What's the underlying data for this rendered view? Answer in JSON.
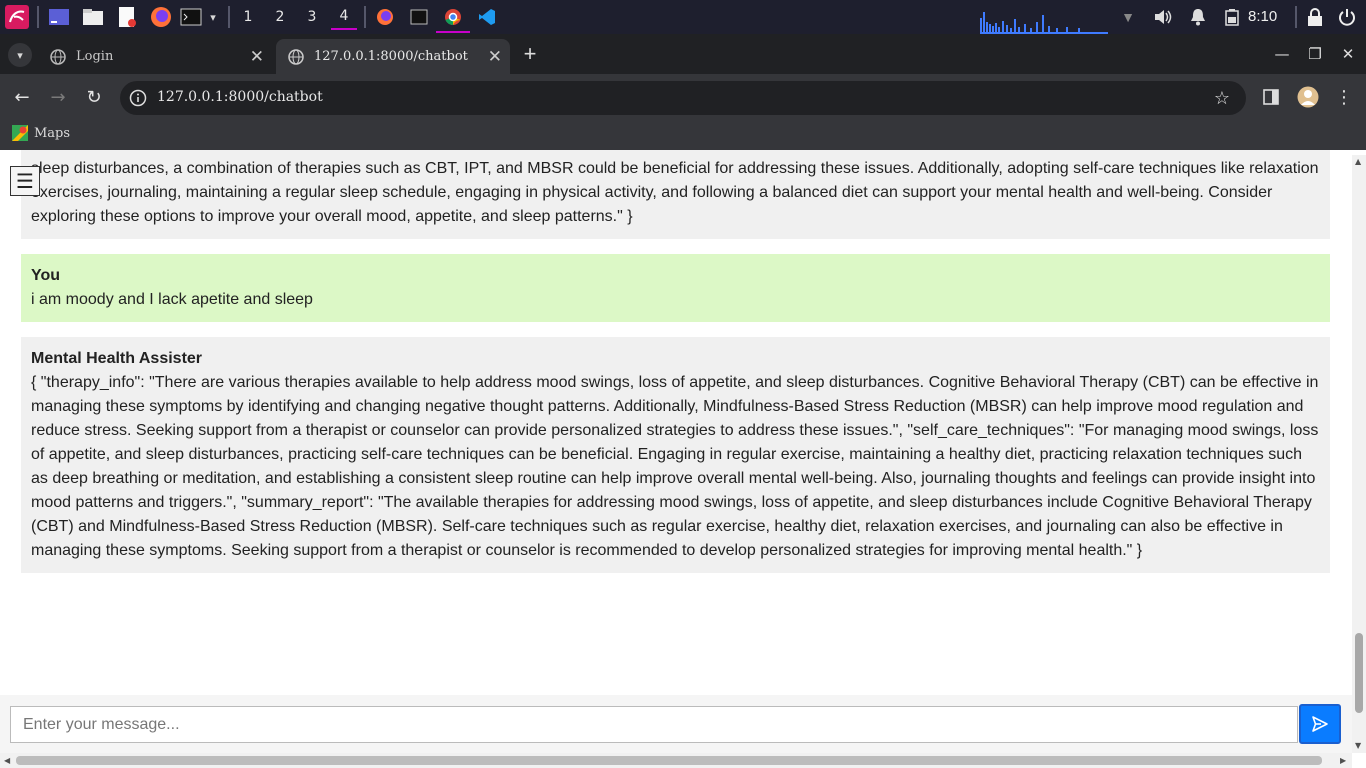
{
  "taskbar": {
    "workspaces": [
      "1",
      "2",
      "3",
      "4"
    ],
    "active_workspace": "4",
    "clock": "8:10"
  },
  "browser": {
    "tabs": [
      {
        "title": "Login",
        "active": false
      },
      {
        "title": "127.0.0.1:8000/chatbot",
        "active": true
      }
    ],
    "new_tab": "+",
    "url": "127.0.0.1:8000/chatbot",
    "bookmarks": [
      {
        "label": "Maps"
      }
    ]
  },
  "chat": {
    "menu_glyph": "☰",
    "messages": [
      {
        "sender": "",
        "role": "bot",
        "text": "sleep disturbances, a combination of therapies such as CBT, IPT, and MBSR could be beneficial for addressing these issues. Additionally, adopting self-care techniques like relaxation exercises, journaling, maintaining a regular sleep schedule, engaging in physical activity, and following a balanced diet can support your mental health and well-being. Consider exploring these options to improve your overall mood, appetite, and sleep patterns.\" }"
      },
      {
        "sender": "You",
        "role": "user",
        "text": "i am moody and I lack apetite and sleep"
      },
      {
        "sender": "Mental Health Assister",
        "role": "bot",
        "text": "{ \"therapy_info\": \"There are various therapies available to help address mood swings, loss of appetite, and sleep disturbances. Cognitive Behavioral Therapy (CBT) can be effective in managing these symptoms by identifying and changing negative thought patterns. Additionally, Mindfulness-Based Stress Reduction (MBSR) can help improve mood regulation and reduce stress. Seeking support from a therapist or counselor can provide personalized strategies to address these issues.\", \"self_care_techniques\": \"For managing mood swings, loss of appetite, and sleep disturbances, practicing self-care techniques can be beneficial. Engaging in regular exercise, maintaining a healthy diet, practicing relaxation techniques such as deep breathing or meditation, and establishing a consistent sleep routine can help improve overall mental well-being. Also, journaling thoughts and feelings can provide insight into mood patterns and triggers.\", \"summary_report\": \"The available therapies for addressing mood swings, loss of appetite, and sleep disturbances include Cognitive Behavioral Therapy (CBT) and Mindfulness-Based Stress Reduction (MBSR). Self-care techniques such as regular exercise, healthy diet, relaxation exercises, and journaling can also be effective in managing these symptoms. Seeking support from a therapist or counselor is recommended to develop personalized strategies for improving mental health.\" }"
      }
    ],
    "input": {
      "placeholder": "Enter your message...",
      "value": ""
    }
  },
  "colors": {
    "bot_bubble": "#f0f0f0",
    "user_bubble": "#dcf8c6",
    "send_button": "#0a7cff",
    "taskbar": "#1e1f2e",
    "accent": "#c800c8"
  }
}
